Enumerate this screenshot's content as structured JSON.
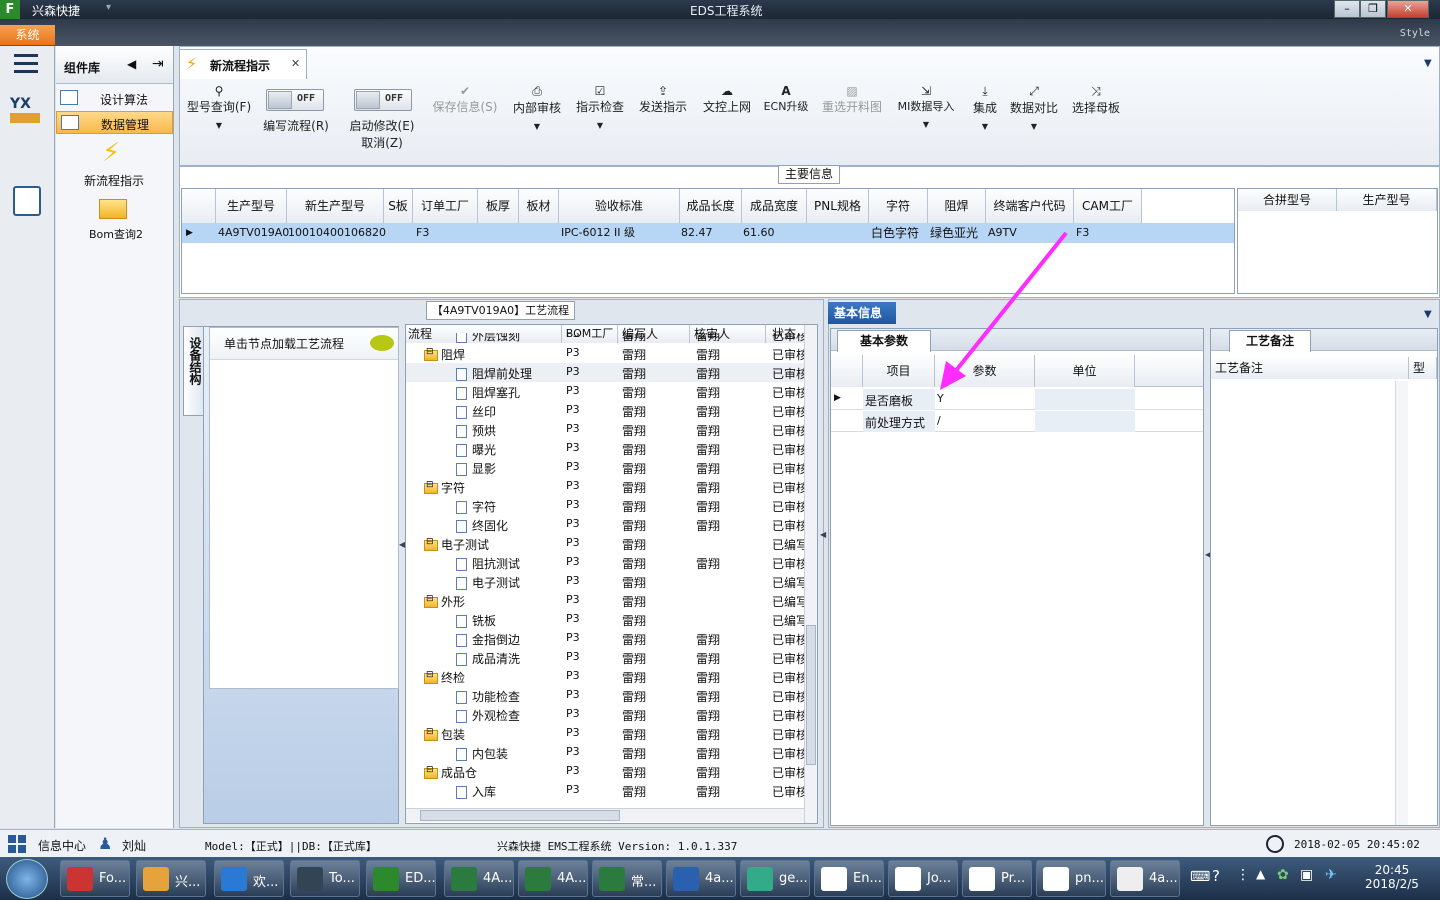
{
  "window": {
    "app_title": "兴森快捷",
    "title": "EDS工程系统",
    "system_btn": "系统",
    "style_label": "Style"
  },
  "left_panel": {
    "header": "组件库",
    "items": [
      {
        "label": "设计算法"
      },
      {
        "label": "数据管理"
      }
    ],
    "tools": [
      {
        "label": "新流程指示"
      },
      {
        "label": "Bom查询2"
      }
    ]
  },
  "tab": {
    "label": "新流程指示"
  },
  "toolbar": {
    "buttons": [
      "型号查询(F)",
      "编写流程(R)",
      "启动修改(E)",
      "取消(Z)",
      "保存信息(S)",
      "内部审核",
      "指示检查",
      "发送指示",
      "文控上网",
      "ECN升级",
      "重选开料图",
      "MI数据导入",
      "集成",
      "数据对比",
      "选择母板"
    ],
    "toggle_off": "OFF"
  },
  "main_info": {
    "title": "主要信息",
    "columns": [
      "生产型号",
      "新生产型号",
      "S板",
      "订单工厂",
      "板厚",
      "板材",
      "验收标准",
      "成品长度",
      "成品宽度",
      "PNL规格",
      "字符",
      "阻焊",
      "终端客户代码",
      "CAM工厂"
    ],
    "row": [
      "4A9TV019A0",
      "10010400106820",
      "",
      "F3",
      "",
      "",
      "IPC-6012 II 级",
      "82.47",
      "61.60",
      "",
      "白色字符",
      "绿色亚光",
      "A9TV",
      "F3"
    ],
    "right_columns": [
      "合拼型号",
      "生产型号"
    ]
  },
  "process": {
    "title": "【4A9TV019A0】工艺流程",
    "side_tab": "设备结构",
    "hint": "单击节点加载工艺流程",
    "columns": [
      "流程",
      "BOM工厂",
      "编写人",
      "核审人",
      "状态"
    ],
    "rows": [
      {
        "name": "外层蚀刻",
        "level": 1,
        "type": "doc",
        "bom": "P3",
        "writer": "雷翔",
        "reviewer": "雷翔",
        "status": "已审核"
      },
      {
        "name": "阻焊",
        "level": 0,
        "type": "folder",
        "bom": "P3",
        "writer": "雷翔",
        "reviewer": "雷翔",
        "status": "已审核"
      },
      {
        "name": "阻焊前处理",
        "level": 1,
        "type": "doc",
        "bom": "P3",
        "writer": "雷翔",
        "reviewer": "雷翔",
        "status": "已审核"
      },
      {
        "name": "阻焊塞孔",
        "level": 1,
        "type": "doc",
        "bom": "P3",
        "writer": "雷翔",
        "reviewer": "雷翔",
        "status": "已审核"
      },
      {
        "name": "丝印",
        "level": 1,
        "type": "doc",
        "bom": "P3",
        "writer": "雷翔",
        "reviewer": "雷翔",
        "status": "已审核"
      },
      {
        "name": "预烘",
        "level": 1,
        "type": "doc",
        "bom": "P3",
        "writer": "雷翔",
        "reviewer": "雷翔",
        "status": "已审核"
      },
      {
        "name": "曝光",
        "level": 1,
        "type": "doc",
        "bom": "P3",
        "writer": "雷翔",
        "reviewer": "雷翔",
        "status": "已审核"
      },
      {
        "name": "显影",
        "level": 1,
        "type": "doc",
        "bom": "P3",
        "writer": "雷翔",
        "reviewer": "雷翔",
        "status": "已审核"
      },
      {
        "name": "字符",
        "level": 0,
        "type": "folder",
        "bom": "P3",
        "writer": "雷翔",
        "reviewer": "雷翔",
        "status": "已审核"
      },
      {
        "name": "字符",
        "level": 1,
        "type": "doc",
        "bom": "P3",
        "writer": "雷翔",
        "reviewer": "雷翔",
        "status": "已审核"
      },
      {
        "name": "终固化",
        "level": 1,
        "type": "doc",
        "bom": "P3",
        "writer": "雷翔",
        "reviewer": "雷翔",
        "status": "已审核"
      },
      {
        "name": "电子测试",
        "level": 0,
        "type": "folder",
        "bom": "P3",
        "writer": "雷翔",
        "reviewer": "",
        "status": "已编写"
      },
      {
        "name": "阻抗测试",
        "level": 1,
        "type": "doc",
        "bom": "P3",
        "writer": "雷翔",
        "reviewer": "雷翔",
        "status": "已审核"
      },
      {
        "name": "电子测试",
        "level": 1,
        "type": "doc",
        "bom": "P3",
        "writer": "雷翔",
        "reviewer": "",
        "status": "已编写"
      },
      {
        "name": "外形",
        "level": 0,
        "type": "folder",
        "bom": "P3",
        "writer": "雷翔",
        "reviewer": "",
        "status": "已编写"
      },
      {
        "name": "铣板",
        "level": 1,
        "type": "doc",
        "bom": "P3",
        "writer": "雷翔",
        "reviewer": "",
        "status": "已编写"
      },
      {
        "name": "金指倒边",
        "level": 1,
        "type": "doc",
        "bom": "P3",
        "writer": "雷翔",
        "reviewer": "雷翔",
        "status": "已审核"
      },
      {
        "name": "成品清洗",
        "level": 1,
        "type": "doc",
        "bom": "P3",
        "writer": "雷翔",
        "reviewer": "雷翔",
        "status": "已审核"
      },
      {
        "name": "终检",
        "level": 0,
        "type": "folder",
        "bom": "P3",
        "writer": "雷翔",
        "reviewer": "雷翔",
        "status": "已审核"
      },
      {
        "name": "功能检查",
        "level": 1,
        "type": "doc",
        "bom": "P3",
        "writer": "雷翔",
        "reviewer": "雷翔",
        "status": "已审核"
      },
      {
        "name": "外观检查",
        "level": 1,
        "type": "doc",
        "bom": "P3",
        "writer": "雷翔",
        "reviewer": "雷翔",
        "status": "已审核"
      },
      {
        "name": "包装",
        "level": 0,
        "type": "folder",
        "bom": "P3",
        "writer": "雷翔",
        "reviewer": "雷翔",
        "status": "已审核"
      },
      {
        "name": "内包装",
        "level": 1,
        "type": "doc",
        "bom": "P3",
        "writer": "雷翔",
        "reviewer": "雷翔",
        "status": "已审核"
      },
      {
        "name": "成品仓",
        "level": 0,
        "type": "folder",
        "bom": "P3",
        "writer": "雷翔",
        "reviewer": "雷翔",
        "status": "已审核"
      },
      {
        "name": "入库",
        "level": 1,
        "type": "doc",
        "bom": "P3",
        "writer": "雷翔",
        "reviewer": "雷翔",
        "status": "已审核"
      }
    ]
  },
  "basic_info": {
    "tab": "基本信息",
    "subtab": "基本参数",
    "columns": [
      "项目",
      "参数",
      "单位"
    ],
    "rows": [
      {
        "item": "是否磨板",
        "param": "Y",
        "unit": ""
      },
      {
        "item": "前处理方式",
        "param": "/",
        "unit": ""
      }
    ]
  },
  "remarks": {
    "tab": "工艺备注",
    "columns": [
      "工艺备注",
      "型"
    ]
  },
  "status": {
    "info_center": "信息中心",
    "user": "刘灿",
    "model": "Model:【正式】||DB:【正式库】",
    "version": "兴森快捷 EMS工程系统 Version: 1.0.1.337",
    "datetime": "2018-02-05 20:45:02"
  },
  "taskbar": {
    "items": [
      "Fo...",
      "兴...",
      "欢...",
      "To...",
      "ED...",
      "4A...",
      "4A...",
      "常...",
      "4a...",
      "ge...",
      "En...",
      "Jo...",
      "Pr...",
      "pn...",
      "4a..."
    ],
    "time": "20:45",
    "date": "2018/2/5"
  },
  "colors": {
    "accent": "#f28a2b",
    "selection": "#b7d6f5",
    "arrow": "#ff2cff"
  }
}
